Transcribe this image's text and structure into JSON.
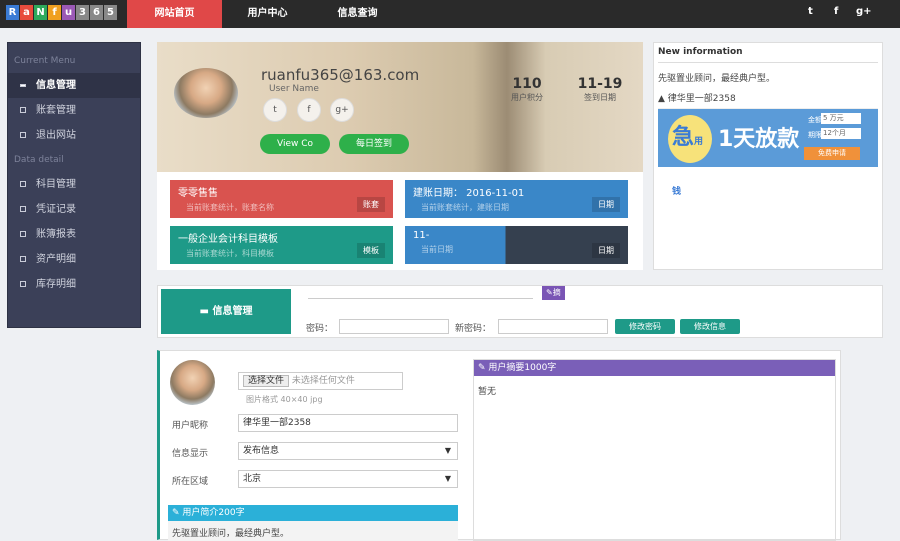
{
  "nav": {
    "logo": "RaNfu365",
    "logo_letters": [
      "R",
      "a",
      "N",
      "f",
      "u",
      "3",
      "6",
      "5"
    ],
    "tabs": [
      "网站首页",
      "用户中心",
      "信息查询"
    ],
    "social": [
      "t",
      "f",
      "g+"
    ]
  },
  "sidebar": {
    "section1": "Current Menu",
    "items1": [
      "信息管理",
      "账套管理",
      "退出网站"
    ],
    "section2": "Data detail",
    "items2": [
      "科目管理",
      "凭证记录",
      "账簿报表",
      "资产明细",
      "库存明细"
    ]
  },
  "profile": {
    "email": "ruanfu365@163.com",
    "username_label": "User Name",
    "social": [
      "t",
      "f",
      "g+"
    ],
    "view_btn": "View Co",
    "checkin_btn": "每日签到",
    "stats": [
      {
        "value": "110",
        "label": "用户积分"
      },
      {
        "value": "11-19",
        "label": "签到日期"
      }
    ]
  },
  "tiles": [
    {
      "title": "零零售售",
      "sub": "当前账套统计，账套名称",
      "badge": "账套",
      "color": "#d9534f"
    },
    {
      "title": "建账日期： 2016-11-01",
      "sub": "当前账套统计，建账日期",
      "badge": "日期",
      "color": "#3a87c8"
    },
    {
      "title": "一般企业会计科目模板",
      "sub": "当前账套统计，科目模板",
      "badge": "模板",
      "color": "#1e9a88"
    },
    {
      "title": "11-",
      "sub": "当前日期",
      "badge": "日期",
      "color": "#35404f"
    }
  ],
  "newinfo": {
    "title": "New information",
    "text": "先驱置业顾问，最经典户型。",
    "user": "律华里一部2358",
    "ad": {
      "big": "急",
      "small": "用钱",
      "main": "1天放款",
      "amount_label": "金额",
      "amount": "5 万元",
      "term_label": "期限",
      "term": "12个月",
      "apply": "免费申请"
    }
  },
  "infobar": {
    "title": "信息管理",
    "edit_btn": "摘",
    "password_label": "密码：",
    "new_password_label": "新密码：",
    "change_pwd_btn": "修改密码",
    "change_info_btn": "修改信息"
  },
  "form": {
    "choose_file": "选择文件",
    "no_file": "未选择任何文件",
    "hint": "图片格式 40×40 jpg",
    "nickname_label": "用户昵称",
    "nickname": "律华里一部2358",
    "display_label": "信息显示",
    "display": "发布信息",
    "region_label": "所在区域",
    "region": "北京",
    "intro_header": "用户简介200字",
    "intro": "先驱置业顾问，最经典户型。",
    "summary_header": "用户摘要1000字",
    "summary": "暂无"
  }
}
